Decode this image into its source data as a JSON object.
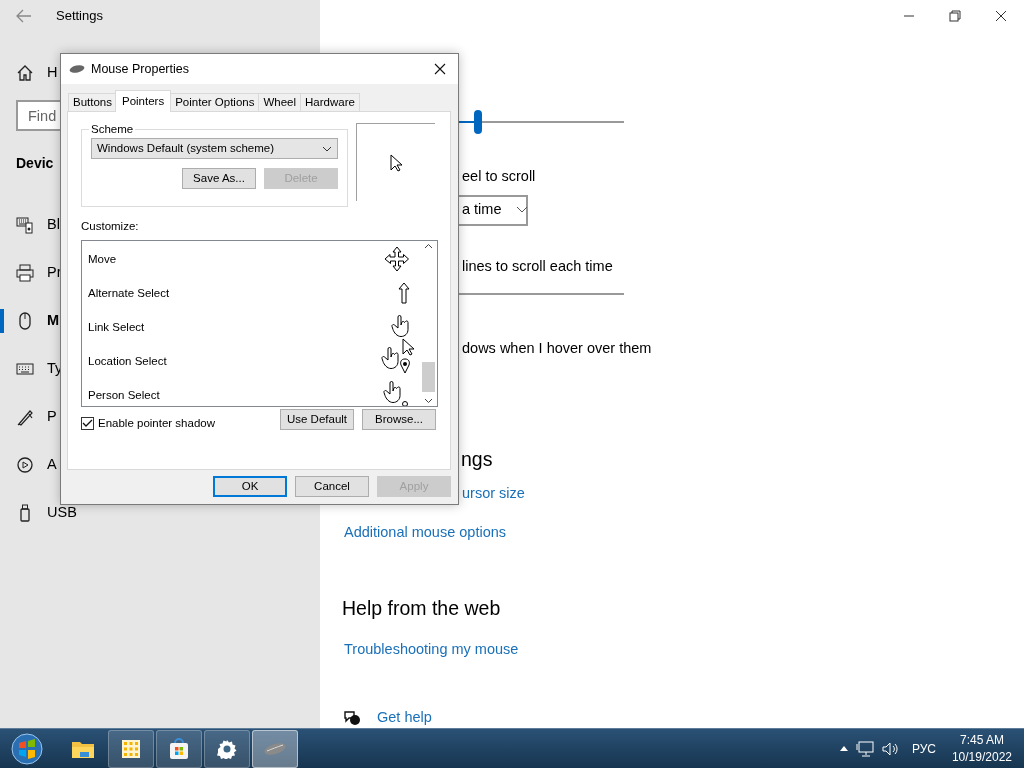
{
  "settings": {
    "title": "Settings",
    "sidebar": {
      "home": "H",
      "search": {
        "placeholder": "Find"
      },
      "section": "Devic",
      "items": [
        {
          "kind": "device",
          "label": "Bl",
          "selected": false
        },
        {
          "kind": "printer",
          "label": "Pr",
          "selected": false
        },
        {
          "kind": "mouse",
          "label": "M",
          "selected": true
        },
        {
          "kind": "keyboard",
          "label": "Ty",
          "selected": false
        },
        {
          "kind": "pen",
          "label": "P",
          "selected": false
        },
        {
          "kind": "autoplay",
          "label": "A",
          "selected": false
        },
        {
          "kind": "usb",
          "label": "USB",
          "selected": false
        }
      ]
    },
    "main": {
      "cursor_slider": {
        "level": 0.48
      },
      "scroll_label": "eel to scroll",
      "scroll_dropdown": "a time",
      "lines_label": "lines to scroll each time",
      "hover_label": "dows when I hover over them",
      "related_heading": "ngs",
      "related_links": [
        "ursor size",
        "Additional mouse options"
      ],
      "help_heading": "Help from the web",
      "help_links": [
        "Troubleshooting my mouse"
      ],
      "get_help": "Get help"
    }
  },
  "dialog": {
    "title": "Mouse Properties",
    "tabs": [
      {
        "label": "Buttons",
        "selected": false
      },
      {
        "label": "Pointers",
        "selected": true
      },
      {
        "label": "Pointer Options",
        "selected": false
      },
      {
        "label": "Wheel",
        "selected": false
      },
      {
        "label": "Hardware",
        "selected": false
      }
    ],
    "scheme": {
      "label": "Scheme",
      "value": "Windows Default (system scheme)",
      "buttons": [
        {
          "label": "Save As...",
          "disabled": false
        },
        {
          "label": "Delete",
          "disabled": true
        }
      ]
    },
    "customize_label": "Customize:",
    "pointers": [
      {
        "kind": "move",
        "name": "Move"
      },
      {
        "kind": "up",
        "name": "Alternate Select"
      },
      {
        "kind": "hand",
        "name": "Link Select"
      },
      {
        "kind": "hand-pin",
        "name": "Location Select"
      },
      {
        "kind": "hand-person",
        "name": "Person Select"
      }
    ],
    "shadow": {
      "label": "Enable pointer shadow",
      "checked": true
    },
    "pointer_buttons": [
      {
        "label": "Use Default",
        "disabled": false
      },
      {
        "label": "Browse...",
        "disabled": false
      }
    ],
    "footer_buttons": [
      {
        "label": "OK",
        "default": true,
        "disabled": false
      },
      {
        "label": "Cancel",
        "default": false,
        "disabled": false
      },
      {
        "label": "Apply",
        "default": false,
        "disabled": true
      }
    ]
  },
  "taskbar": {
    "items": [
      {
        "kind": "start",
        "open": false,
        "active": false
      },
      {
        "kind": "folder",
        "open": false,
        "active": false
      },
      {
        "kind": "apps",
        "open": true,
        "active": false
      },
      {
        "kind": "store",
        "open": true,
        "active": false
      },
      {
        "kind": "settings",
        "open": true,
        "active": false
      },
      {
        "kind": "mouse",
        "open": true,
        "active": true
      }
    ],
    "language": "РУС",
    "time": "7:45 AM",
    "date": "10/19/2022"
  }
}
